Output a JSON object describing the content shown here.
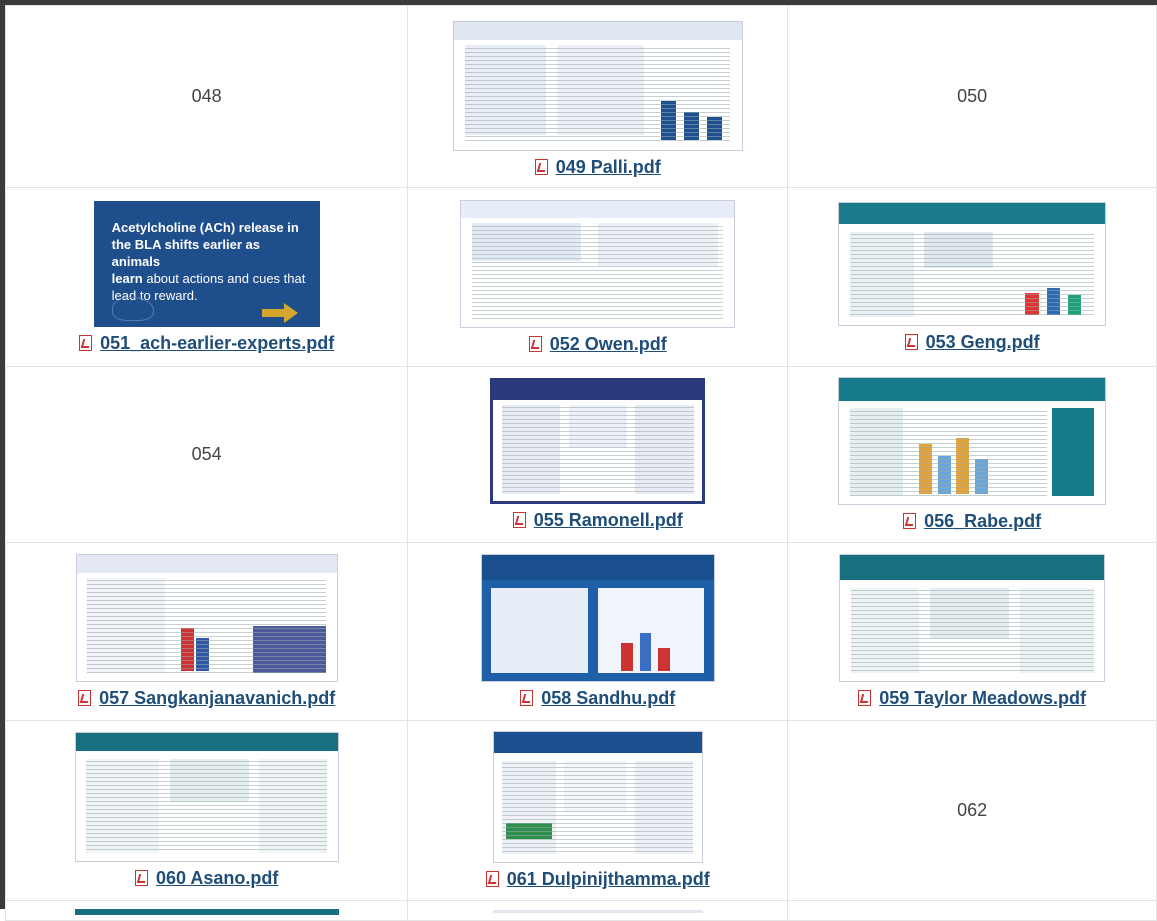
{
  "rows": [
    {
      "c1": {
        "text": "048"
      },
      "c2": {
        "link": "049 Palli.pdf",
        "thumb_color": "#1e4f8f"
      },
      "c3": {
        "text": "050"
      }
    },
    {
      "c1": {
        "link": "051_ach-earlier-experts.pdf",
        "banner": {
          "line1": "Acetylcholine (ACh) release in",
          "line2": "the BLA shifts earlier as animals",
          "line3_bold": "learn",
          "line3_rest": " about actions and cues that",
          "line4": "lead to reward."
        }
      },
      "c2": {
        "link": "052 Owen.pdf",
        "thumb_color": "#2a5d9a"
      },
      "c3": {
        "link": "053 Geng.pdf",
        "thumb_color": "#1a7c8c"
      }
    },
    {
      "c1": {
        "text": "054"
      },
      "c2": {
        "link": "055 Ramonell.pdf",
        "thumb_color": "#2b3a7a"
      },
      "c3": {
        "link": "056_Rabe.pdf",
        "thumb_color": "#157a8a"
      }
    },
    {
      "c1": {
        "link": "057 Sangkanjanavanich.pdf",
        "thumb_color": "#4a5a9a"
      },
      "c2": {
        "link": "058 Sandhu.pdf",
        "thumb_color": "#1f5fa8"
      },
      "c3": {
        "link": "059 Taylor Meadows.pdf",
        "thumb_color": "#16707f"
      }
    },
    {
      "c1": {
        "link": "060 Asano.pdf",
        "thumb_color": "#17707e"
      },
      "c2": {
        "link": "061 Dulpinijthamma.pdf",
        "thumb_color": "#1c4f90"
      },
      "c3": {
        "text": "062"
      }
    }
  ]
}
